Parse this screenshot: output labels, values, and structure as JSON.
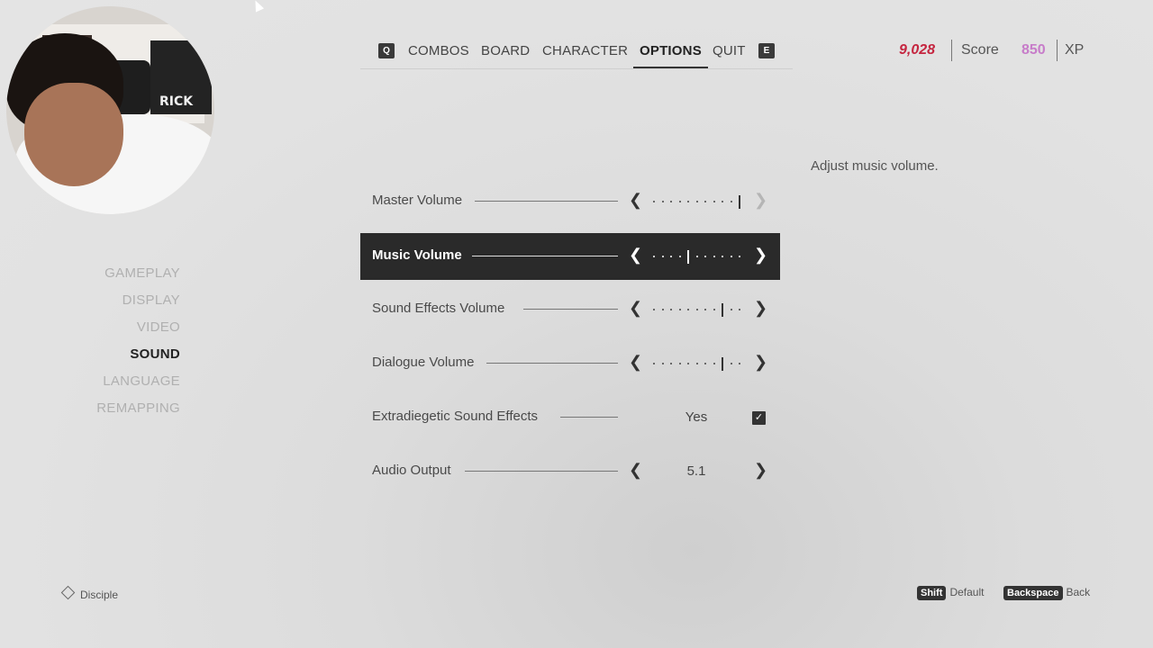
{
  "nav": {
    "left_key": "Q",
    "right_key": "E",
    "tabs": [
      {
        "label": "COMBOS",
        "active": false
      },
      {
        "label": "BOARD",
        "active": false
      },
      {
        "label": "CHARACTER",
        "active": false
      },
      {
        "label": "OPTIONS",
        "active": true
      },
      {
        "label": "QUIT",
        "active": false
      }
    ]
  },
  "stats": {
    "score_value": "9,028",
    "score_label": "Score",
    "xp_value": "850",
    "xp_label": "XP",
    "score_color": "#c52640",
    "xp_color": "#c77cc9"
  },
  "description": "Adjust music volume.",
  "side_menu": {
    "items": [
      {
        "label": "GAMEPLAY",
        "active": false
      },
      {
        "label": "DISPLAY",
        "active": false
      },
      {
        "label": "VIDEO",
        "active": false
      },
      {
        "label": "SOUND",
        "active": true
      },
      {
        "label": "LANGUAGE",
        "active": false
      },
      {
        "label": "REMAPPING",
        "active": false
      }
    ]
  },
  "settings": [
    {
      "label": "Master Volume",
      "type": "slider",
      "level_step": 10,
      "steps": 10,
      "selected": false,
      "right_arrow_enabled": false
    },
    {
      "label": "Music Volume",
      "type": "slider",
      "level_step": 4,
      "steps": 10,
      "selected": true,
      "right_arrow_enabled": true
    },
    {
      "label": "Sound Effects Volume",
      "type": "slider",
      "level_step": 8,
      "steps": 10,
      "selected": false,
      "right_arrow_enabled": true
    },
    {
      "label": "Dialogue Volume",
      "type": "slider",
      "level_step": 8,
      "steps": 10,
      "selected": false,
      "right_arrow_enabled": true
    },
    {
      "label": "Extradiegetic Sound Effects",
      "type": "toggle",
      "value": "Yes",
      "checked": true,
      "selected": false
    },
    {
      "label": "Audio Output",
      "type": "choice",
      "value": "5.1",
      "selected": false
    }
  ],
  "footer": {
    "profile_label": "Disciple",
    "hints": [
      {
        "key": "Shift",
        "label": "Default"
      },
      {
        "key": "Backspace",
        "label": "Back"
      }
    ]
  },
  "webcam": {
    "poster_text": "RICK"
  }
}
